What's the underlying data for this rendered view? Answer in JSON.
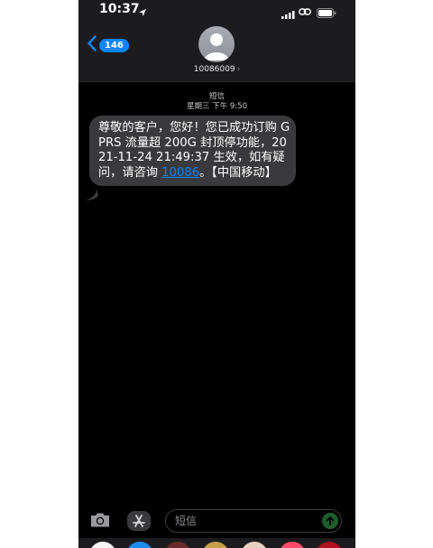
{
  "status_bar": {
    "time": "10:37",
    "icons": [
      "location-arrow-icon",
      "signal-icon",
      "link-icon",
      "battery-icon"
    ]
  },
  "header": {
    "back_badge": "146",
    "contact": "10086009",
    "contact_chevron": "›"
  },
  "thread": {
    "label": "短信",
    "timestamp": "星期三 下午 9:50"
  },
  "message": {
    "text_before_link": "尊敬的客户，您好！您已成功订购 GPRS 流量超 200G 封顶停功能，2021-11-24 21:49:37 生效，如有疑问，请咨询 ",
    "link": "10086",
    "text_after_link": "。【中国移动】"
  },
  "composer": {
    "placeholder": "短信"
  },
  "colors": {
    "accent": "#0a84ff",
    "bubble": "#3a3a3c",
    "background": "#000000",
    "send_button": "#1f5d2e"
  },
  "app_strip": {
    "icons": [
      "photos-app-icon",
      "app-store-icon",
      "app-icon-3",
      "app-icon-4",
      "app-icon-5",
      "music-app-icon",
      "app-icon-7"
    ]
  }
}
